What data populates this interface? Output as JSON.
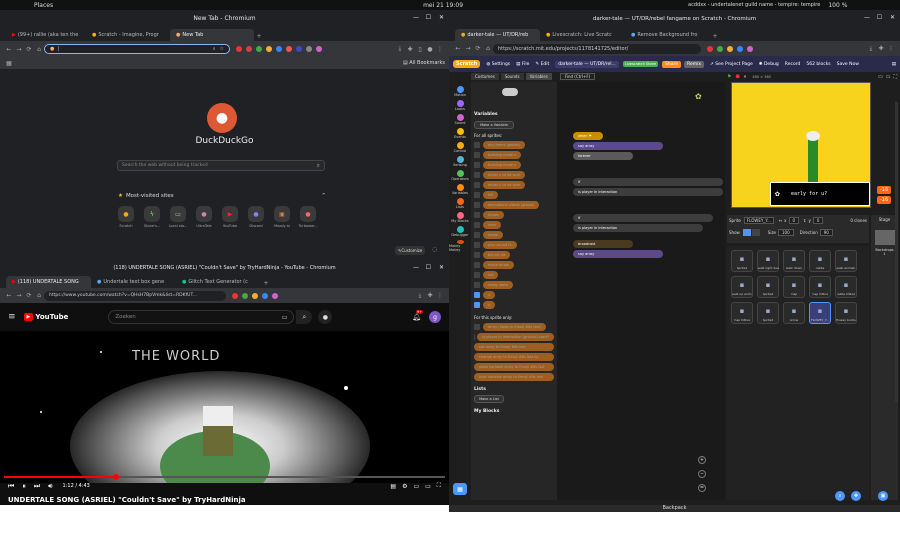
{
  "topbar": {
    "places": "Places",
    "datetime": "mei 21  19:09",
    "right_text": "acddxx - undertalenet guild name - tempire: tempire",
    "battery": "100 %"
  },
  "win1": {
    "title": "New Tab - Chromium",
    "tabs": [
      "(99+) rallie (aka ten the",
      "Scratch - Imagine, Progr",
      "New Tab"
    ],
    "bookmarks_label": "All Bookmarks",
    "ddg_name": "DuckDuckGo",
    "search_placeholder": "Search the web without being tracked",
    "most_visited": "Most-visited sites",
    "tiles": [
      "Scratch",
      "Stone's...",
      "Local sto...",
      "UltraTale",
      "YouTube",
      "Discord",
      "Moody ai",
      "Turbowar..."
    ],
    "customize": "Customize"
  },
  "win2": {
    "title": "darker-tale — UT/DR/rebel fangame on Scratch - Chromium",
    "tabs": [
      "darker-tale — UT/DR/reb",
      "Livescratch: Live Scratc",
      "Remove Background fro"
    ],
    "url": "https://scratch.mit.edu/projects/1178141725/editor/",
    "menu": {
      "settings": "Settings",
      "file": "File",
      "edit": "Edit",
      "project_title": "darker-tale — UT/DR/rel...",
      "livescratch": "Livescratch Share",
      "share": "Share",
      "remix": "Remix",
      "see_project": "See Project Page",
      "debug": "Debug",
      "record": "Record",
      "blocks_count": "562 blocks",
      "save_now": "Save Now"
    },
    "editor_tabs": [
      "Costumes",
      "Sounds",
      "Variables"
    ],
    "sprite_search": "Find (Ctrl+F)",
    "categories": [
      {
        "name": "Motion",
        "color": "#4c97ff"
      },
      {
        "name": "Looks",
        "color": "#9966ff"
      },
      {
        "name": "Sound",
        "color": "#cf63cf"
      },
      {
        "name": "Events",
        "color": "#ffbf00"
      },
      {
        "name": "Control",
        "color": "#ffab19"
      },
      {
        "name": "Sensing",
        "color": "#5cb1d6"
      },
      {
        "name": "Operators",
        "color": "#59c059"
      },
      {
        "name": "Variables",
        "color": "#ff8c1a"
      },
      {
        "name": "Lists",
        "color": "#ff661a"
      },
      {
        "name": "My Blocks",
        "color": "#ff6680"
      },
      {
        "name": "Debugger",
        "color": "#29beb8"
      },
      {
        "name": "Makey Makey",
        "color": "#e64d00"
      }
    ],
    "palette": {
      "variables_heading": "Variables",
      "make_variable": "Make a Variable",
      "for_all_sprites": "For all sprites:",
      "global_vars": [
        "any items (global)",
        "building mode x",
        "building mode y",
        "ender x to be spar",
        "ender y to be spar",
        "kill",
        "animations visible (global)",
        "hitbox",
        "invis",
        "mode",
        "play sound fx",
        "bid sel vis",
        "move arrow",
        "oid",
        "ready state",
        "x",
        "y"
      ],
      "for_this_sprite": "For this sprite only:",
      "local_vars": [
        "array (ideas in Emoji #6s last)",
        "is player in interaction (ground) start?"
      ],
      "set_blocks": [
        "set array to Emoji #6s last",
        "change array to Emoji #6s last by",
        "show variable array to Emoji #6s last",
        "hide variable array to Emoji #6s last"
      ],
      "lists_heading": "Lists",
      "make_list": "Make a List",
      "my_blocks_heading": "My Blocks"
    },
    "stage": {
      "dims": "480 × 360",
      "dialogue": "early for u?",
      "badge1": "-16",
      "badge2": "-16"
    },
    "sprite_info": {
      "sprite_label": "Sprite",
      "sprite_name": "FLOWEY_Y...",
      "x_label": "x",
      "x_value": "0",
      "y_label": "y",
      "y_value": "0",
      "show_label": "Show",
      "size_label": "Size",
      "size_value": "100",
      "direction_label": "Direction",
      "direction_value": "90",
      "clones": "0 clones"
    },
    "sprites": [
      "Sprite1",
      "walk right down",
      "walk down",
      "rabbs",
      "walk animat.",
      "walk up anim.",
      "Sprite2",
      "map",
      "map hitbox",
      "rabbs hitbox",
      "map hitbox",
      "Sprite3",
      "arrow",
      "FLOWEY_Y...",
      "flowey bucks"
    ],
    "stage_panel": {
      "title": "Stage",
      "backdrops_label": "Backdrops",
      "backdrops_count": "1"
    },
    "backpack": "Backpack"
  },
  "win3": {
    "title": "(118) UNDERTALE SONG (ASRIEL) \"Couldn't Save\" by TryHardNinja - YouTube - Chromium",
    "tabs": [
      "(118) UNDERTALE SONG",
      "Undertale text box gene",
      "Glitch Text Generator (c"
    ],
    "url": "https://www.youtube.com/watch?v=QHsH7BpVmk&list=RDKfUT...",
    "search_placeholder": "Zoeken",
    "notif_count": "9+",
    "avatar_letter": "g",
    "video_overlay": "THE WORLD",
    "time": "1:12 / 4:43",
    "video_title": "UNDERTALE SONG (ASRIEL) \"Couldn't Save\" by TryHardNinja",
    "progress": 0.254
  },
  "colors": {
    "scratch_blue": "#4c97ff",
    "yt_red": "#ff0000",
    "stage_yellow": "#f7d31e",
    "variable_orange": "#ff8c1a"
  }
}
